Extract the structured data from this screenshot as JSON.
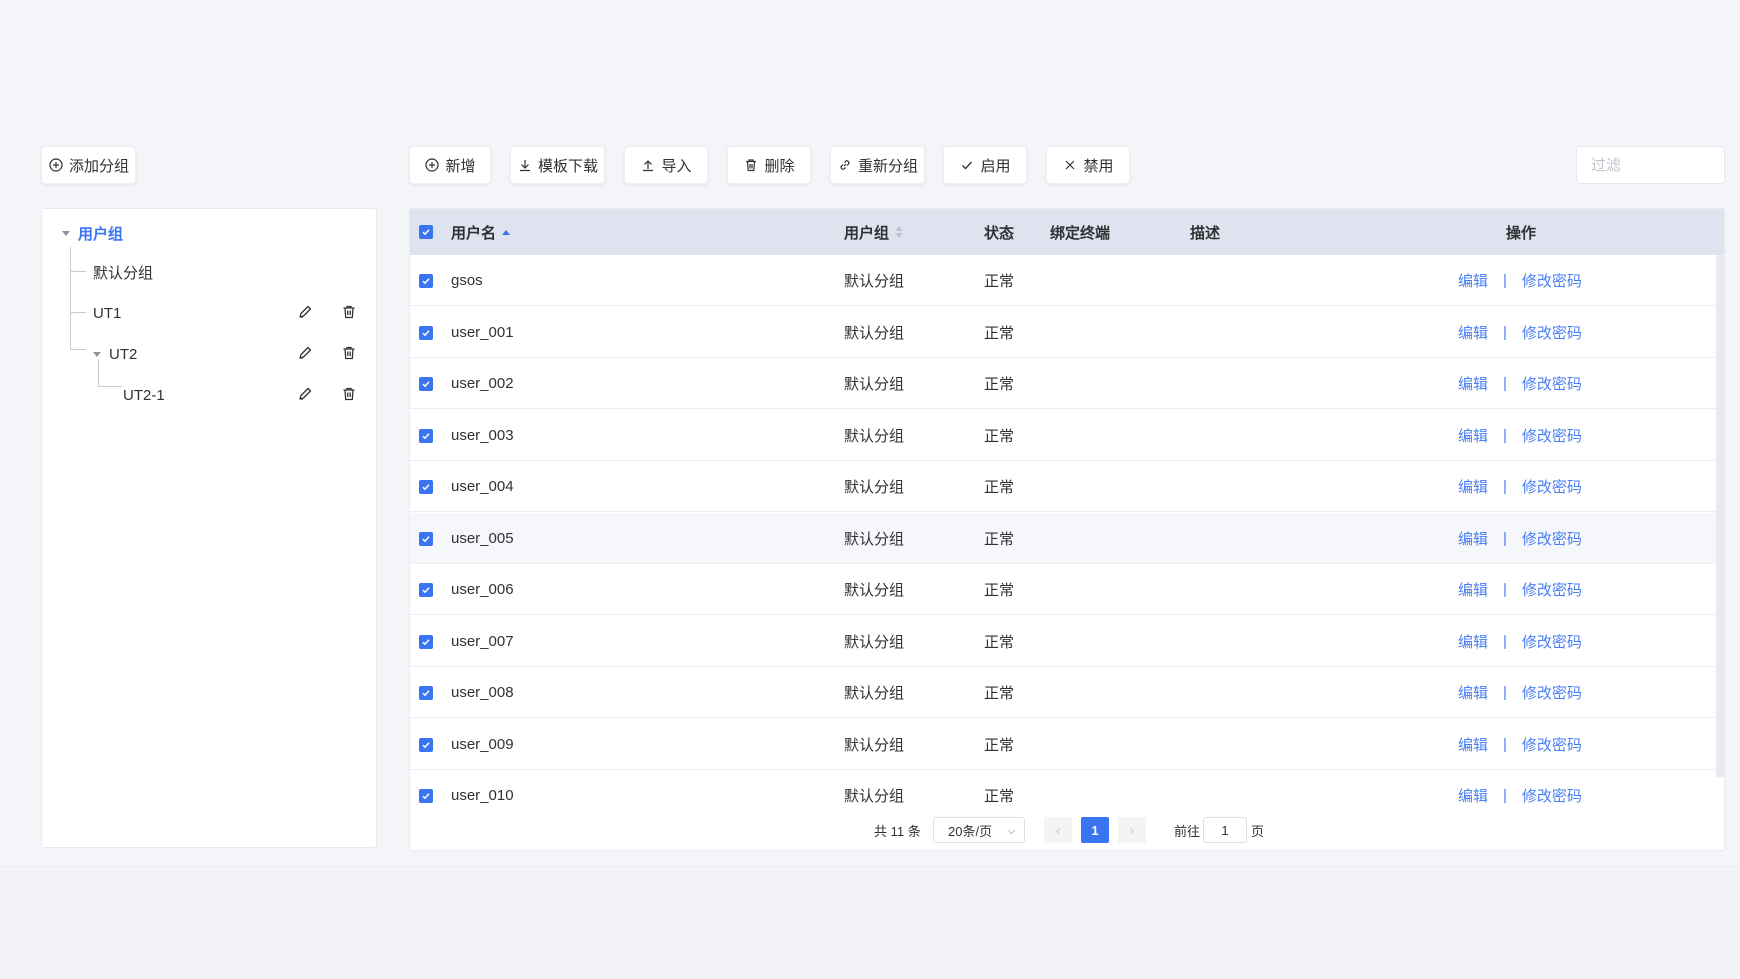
{
  "toolbar": {
    "add_group": "添加分组",
    "add": "新增",
    "template_download": "模板下载",
    "import": "导入",
    "delete": "删除",
    "regroup": "重新分组",
    "enable": "启用",
    "disable": "禁用",
    "filter_placeholder": "过滤"
  },
  "tree": {
    "root": "用户组",
    "nodes": [
      {
        "label": "默认分组"
      },
      {
        "label": "UT1"
      },
      {
        "label": "UT2"
      },
      {
        "label": "UT2-1"
      }
    ]
  },
  "table": {
    "columns": {
      "username": "用户名",
      "group": "用户组",
      "status": "状态",
      "bound_terminal": "绑定终端",
      "description": "描述",
      "actions": "操作"
    },
    "action_edit": "编辑",
    "action_separator": "|",
    "action_change_password": "修改密码",
    "rows": [
      {
        "username": "gsos",
        "group": "默认分组",
        "status": "正常",
        "terminal": "",
        "description": ""
      },
      {
        "username": "user_001",
        "group": "默认分组",
        "status": "正常",
        "terminal": "",
        "description": ""
      },
      {
        "username": "user_002",
        "group": "默认分组",
        "status": "正常",
        "terminal": "",
        "description": ""
      },
      {
        "username": "user_003",
        "group": "默认分组",
        "status": "正常",
        "terminal": "",
        "description": ""
      },
      {
        "username": "user_004",
        "group": "默认分组",
        "status": "正常",
        "terminal": "",
        "description": ""
      },
      {
        "username": "user_005",
        "group": "默认分组",
        "status": "正常",
        "terminal": "",
        "description": ""
      },
      {
        "username": "user_006",
        "group": "默认分组",
        "status": "正常",
        "terminal": "",
        "description": ""
      },
      {
        "username": "user_007",
        "group": "默认分组",
        "status": "正常",
        "terminal": "",
        "description": ""
      },
      {
        "username": "user_008",
        "group": "默认分组",
        "status": "正常",
        "terminal": "",
        "description": ""
      },
      {
        "username": "user_009",
        "group": "默认分组",
        "status": "正常",
        "terminal": "",
        "description": ""
      },
      {
        "username": "user_010",
        "group": "默认分组",
        "status": "正常",
        "terminal": "",
        "description": ""
      }
    ]
  },
  "pagination": {
    "total": "共 11 条",
    "page_size": "20条/页",
    "prev": "‹",
    "current_page": "1",
    "next": "›",
    "goto_label": "前往",
    "goto_value": "1",
    "page_suffix": "页"
  },
  "colors": {
    "accent": "#3b74f2",
    "link": "#4a7ef5",
    "header_bg": "#dfe3ef"
  }
}
